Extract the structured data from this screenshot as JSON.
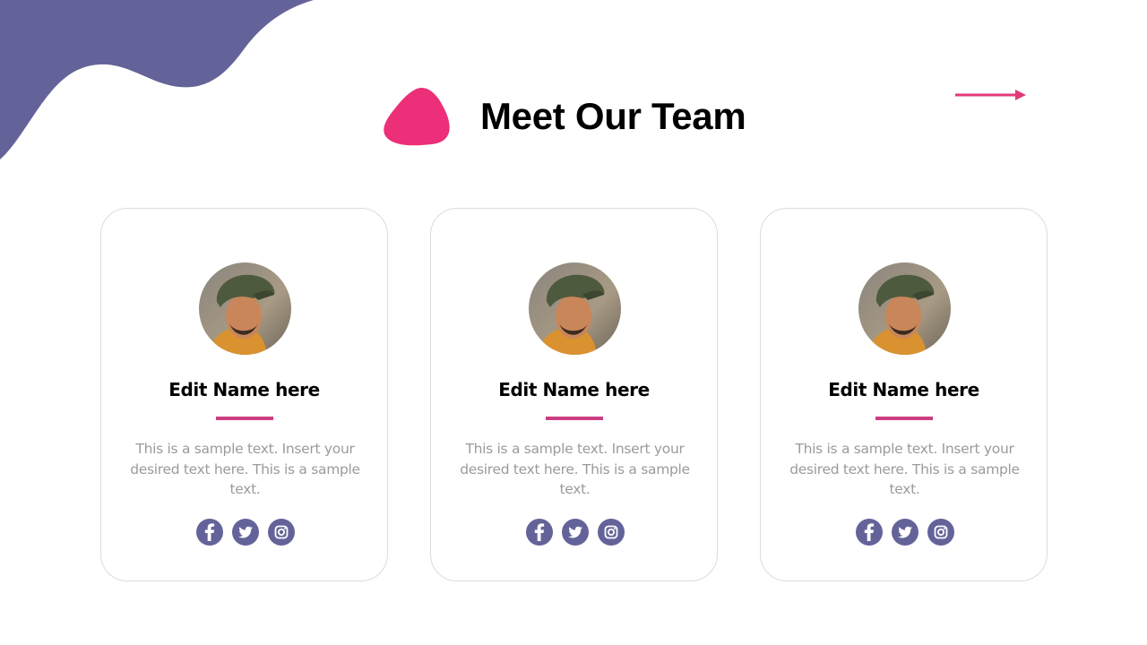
{
  "slide": {
    "title": "Meet Our Team"
  },
  "colors": {
    "purple": "#646399",
    "pink": "#ec2f78",
    "underline": "#cc3e82",
    "text_muted": "#9b9b9b"
  },
  "team": [
    {
      "name": "Edit Name here",
      "description": "This is a sample text. Insert your desired text here. This is a sample text.",
      "socials": [
        "facebook-icon",
        "twitter-icon",
        "instagram-icon"
      ]
    },
    {
      "name": "Edit Name here",
      "description": "This is a sample text. Insert your desired text here. This is a sample text.",
      "socials": [
        "facebook-icon",
        "twitter-icon",
        "instagram-icon"
      ]
    },
    {
      "name": "Edit Name here",
      "description": "This is a sample text. Insert your desired text here. This is a sample text.",
      "socials": [
        "facebook-icon",
        "twitter-icon",
        "instagram-icon"
      ]
    }
  ]
}
